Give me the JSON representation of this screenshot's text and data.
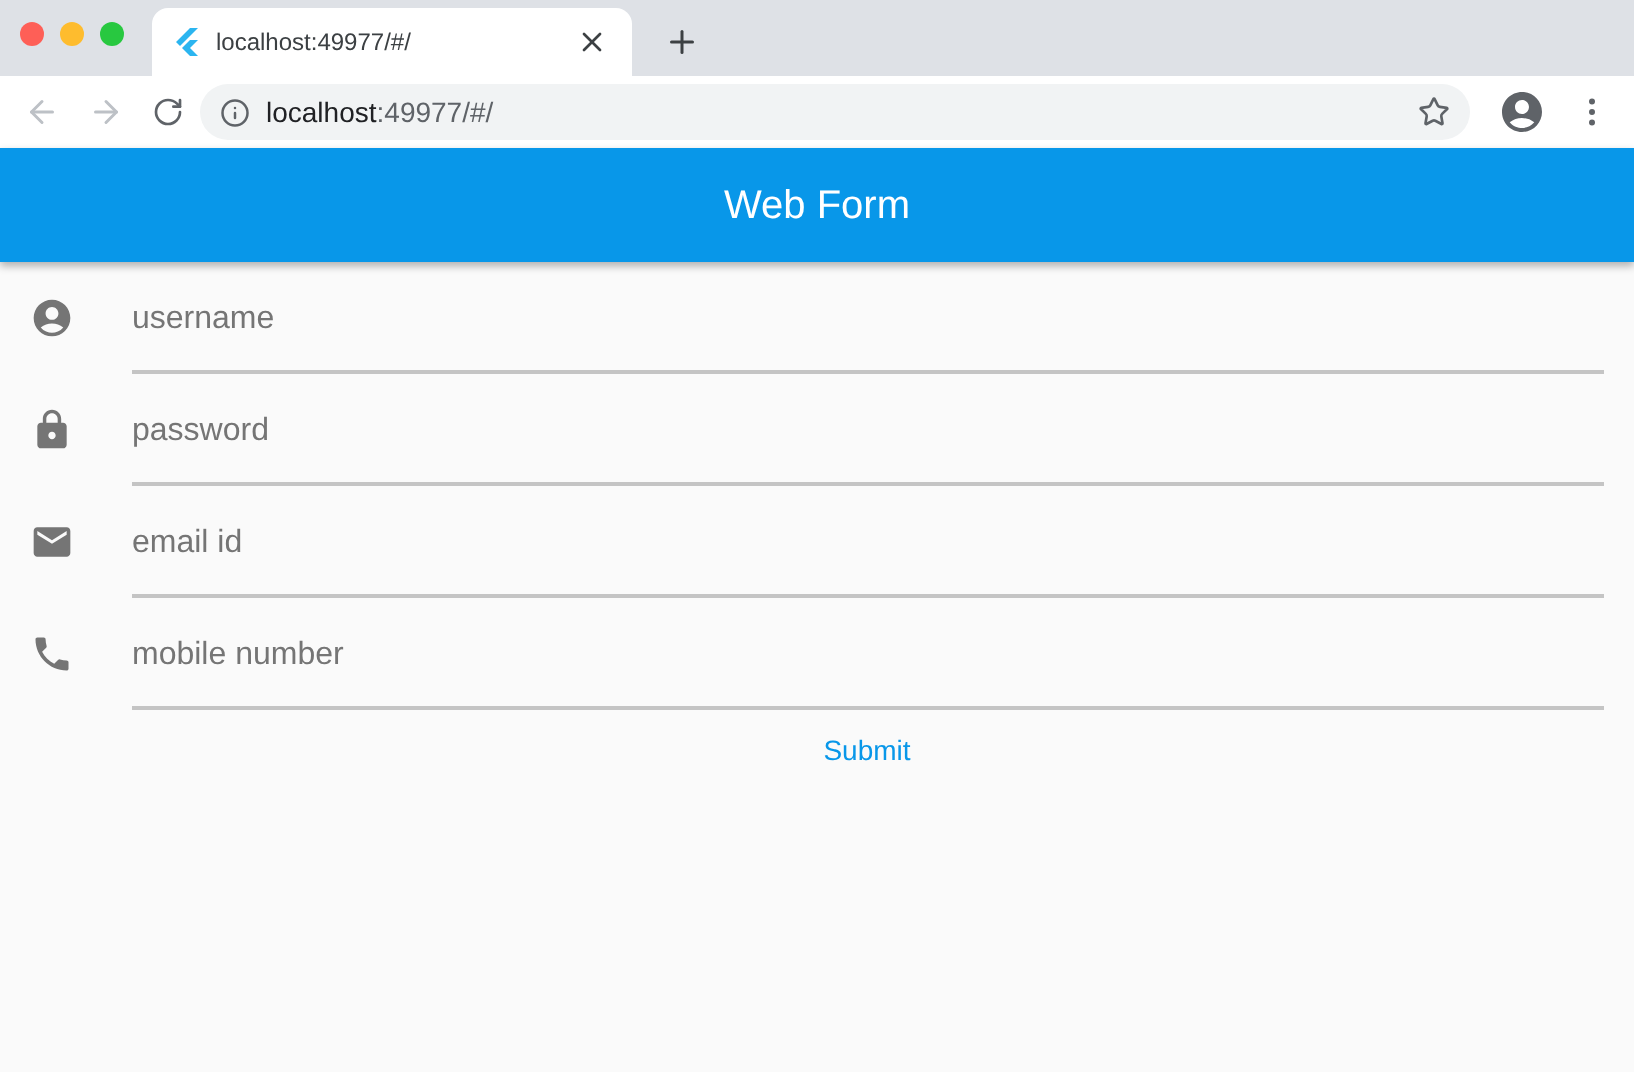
{
  "browser": {
    "tab_title": "localhost:49977/#/",
    "url_host": "localhost",
    "url_rest": ":49977/#/"
  },
  "app_bar": {
    "title": "Web Form"
  },
  "fields": [
    {
      "kind": "person",
      "placeholder": "username"
    },
    {
      "kind": "lock",
      "placeholder": "password"
    },
    {
      "kind": "email",
      "placeholder": "email id"
    },
    {
      "kind": "phone",
      "placeholder": "mobile number"
    }
  ],
  "submit": "Submit"
}
